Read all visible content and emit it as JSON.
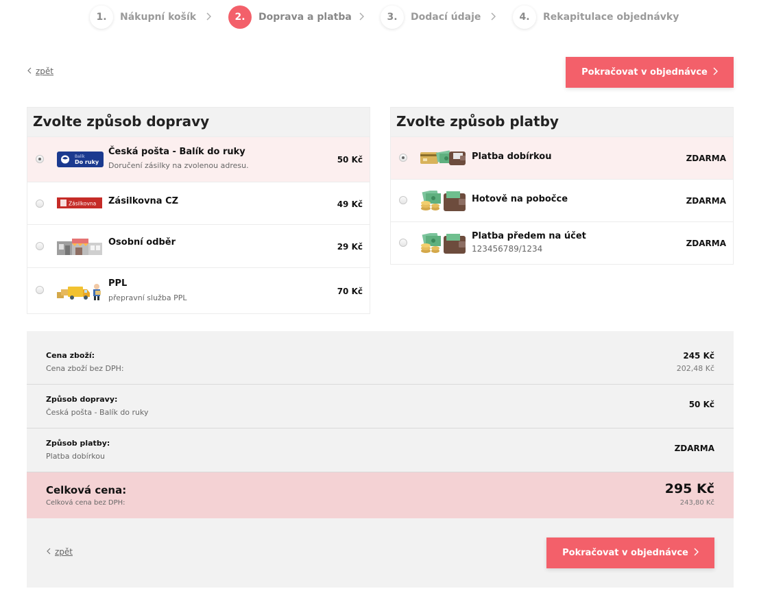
{
  "steps": [
    {
      "num": "1.",
      "label": "Nákupní košík"
    },
    {
      "num": "2.",
      "label": "Doprava a platba"
    },
    {
      "num": "3.",
      "label": "Dodací údaje"
    },
    {
      "num": "4.",
      "label": "Rekapitulace objednávky"
    }
  ],
  "active_step": 2,
  "nav": {
    "back_label": "zpět",
    "continue_label": "Pokračovat v objednávce"
  },
  "shipping": {
    "title": "Zvolte způsob dopravy",
    "options": [
      {
        "name": "Česká pošta - Balík do ruky",
        "desc": "Doručení zásilky na zvolenou adresu.",
        "price": "50 Kč",
        "selected": true,
        "icon": "ceska-posta-logo",
        "logo_text": "Balík Do ruky"
      },
      {
        "name": "Zásilkovna CZ",
        "desc": "",
        "price": "49 Kč",
        "selected": false,
        "icon": "zasilkovna-logo",
        "logo_text": "Zásilkovna"
      },
      {
        "name": "Osobní odběr",
        "desc": "",
        "price": "29 Kč",
        "selected": false,
        "icon": "store-icon"
      },
      {
        "name": "PPL",
        "desc": "přepravní služba PPL",
        "price": "70 Kč",
        "selected": false,
        "icon": "delivery-truck-icon"
      }
    ]
  },
  "payment": {
    "title": "Zvolte způsob platby",
    "options": [
      {
        "name": "Platba dobírkou",
        "desc": "",
        "price": "ZDARMA",
        "selected": true,
        "icon": "card-cash-wallet-icon"
      },
      {
        "name": "Hotově na pobočce",
        "desc": "",
        "price": "ZDARMA",
        "selected": false,
        "icon": "cash-wallet-icon"
      },
      {
        "name": "Platba předem na účet",
        "desc": "123456789/1234",
        "price": "ZDARMA",
        "selected": false,
        "icon": "cash-wallet-icon"
      }
    ]
  },
  "summary": {
    "goods_label": "Cena zboží:",
    "goods_sub": "Cena zboží bez DPH:",
    "goods_value": "245 Kč",
    "goods_sub_value": "202,48 Kč",
    "shipping_label": "Způsob dopravy:",
    "shipping_sub": "Česká pošta - Balík do ruky",
    "shipping_value": "50 Kč",
    "payment_label": "Způsob platby:",
    "payment_sub": "Platba dobírkou",
    "payment_value": "ZDARMA",
    "total_label": "Celková cena:",
    "total_sub": "Celková cena bez DPH:",
    "total_value": "295 Kč",
    "total_sub_value": "243,80 Kč"
  },
  "colors": {
    "accent": "#f3606a",
    "selected_row": "#fcefef",
    "total_row": "#f4d2d4",
    "panel_head": "#f2f2f2"
  }
}
